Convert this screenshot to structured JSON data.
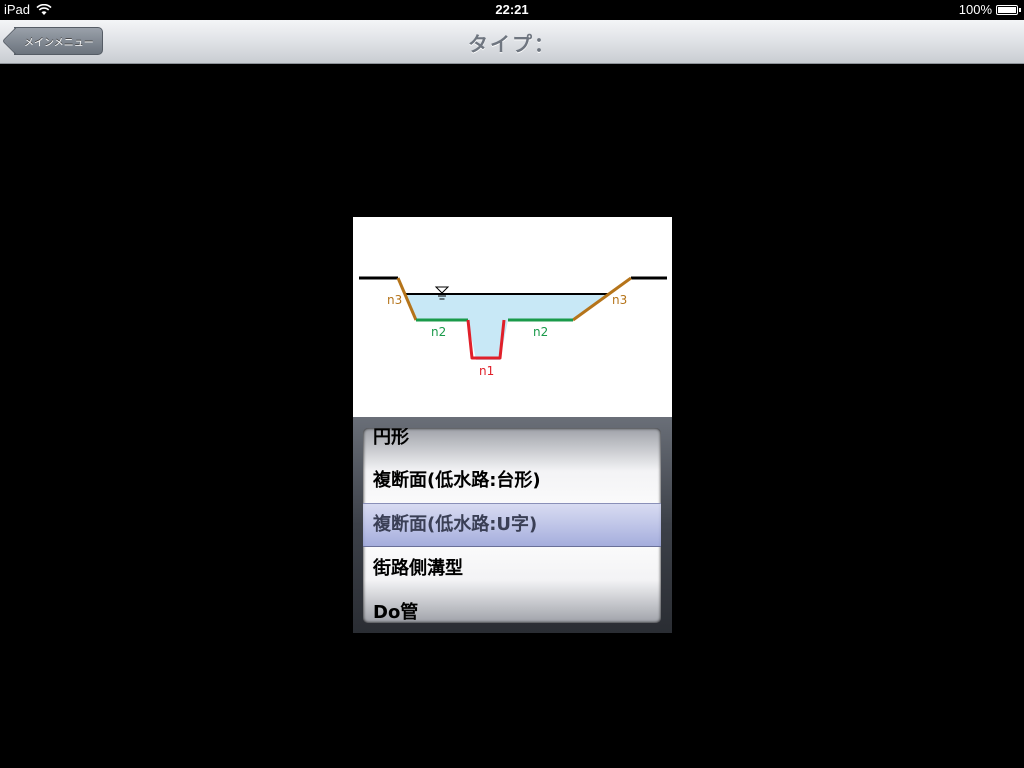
{
  "status_bar": {
    "device": "iPad",
    "time": "22:21",
    "battery_text": "100%",
    "battery_level": 1.0
  },
  "nav_bar": {
    "title": "タイプ：",
    "back_label": "メインメニュー"
  },
  "diagram": {
    "labels": {
      "left_slope": "n3",
      "right_slope": "n3",
      "left_berm": "n2",
      "right_berm": "n2",
      "channel": "n1"
    },
    "colors": {
      "slope": "#b5741a",
      "berm": "#1a9a4a",
      "channel": "#e0202a",
      "water": "#c8e8f6",
      "ground": "#000000"
    }
  },
  "picker": {
    "items": [
      "円形",
      "複断面(低水路:台形)",
      "複断面(低水路:U字)",
      "街路側溝型",
      "Do管"
    ],
    "selected_index": 2
  }
}
